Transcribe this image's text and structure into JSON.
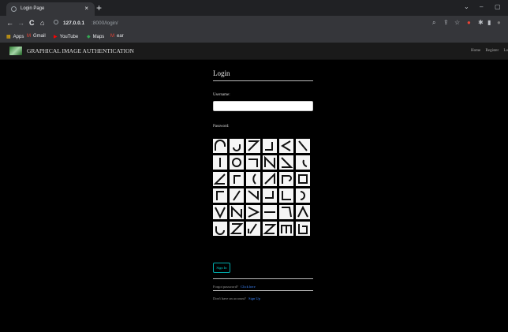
{
  "browser": {
    "tab_title": "Login Page",
    "tab_close": "×",
    "new_tab": "+",
    "url_host": "127.0.0.1",
    "url_path": ":8000/login/",
    "back": "←",
    "forward": "→",
    "reload": "C",
    "home": "⌂",
    "bookmarks": [
      {
        "icon": "apps-grid-icon",
        "label": "Apps"
      },
      {
        "icon": "gmail-icon",
        "label": "Gmail"
      },
      {
        "icon": "youtube-icon",
        "label": "YouTube"
      },
      {
        "icon": "maps-icon",
        "label": "Maps"
      },
      {
        "icon": "gmail-icon",
        "label": "ear"
      }
    ]
  },
  "nav": {
    "brand": "GRAPHICAL IMAGE AUTHENTICATION",
    "links": [
      "Home",
      "Register",
      "Lo"
    ]
  },
  "form": {
    "title": "Login",
    "username_label": "Username:",
    "password_label": "Password:",
    "signin_label": "Sign In",
    "forgot_text": "Forgot password?",
    "forgot_link": "Click here",
    "signup_text": "Don't have an account?",
    "signup_link": "Sign Up"
  },
  "colors": {
    "accent": "#00cccc",
    "link": "#3b82f6",
    "background": "#000000"
  }
}
